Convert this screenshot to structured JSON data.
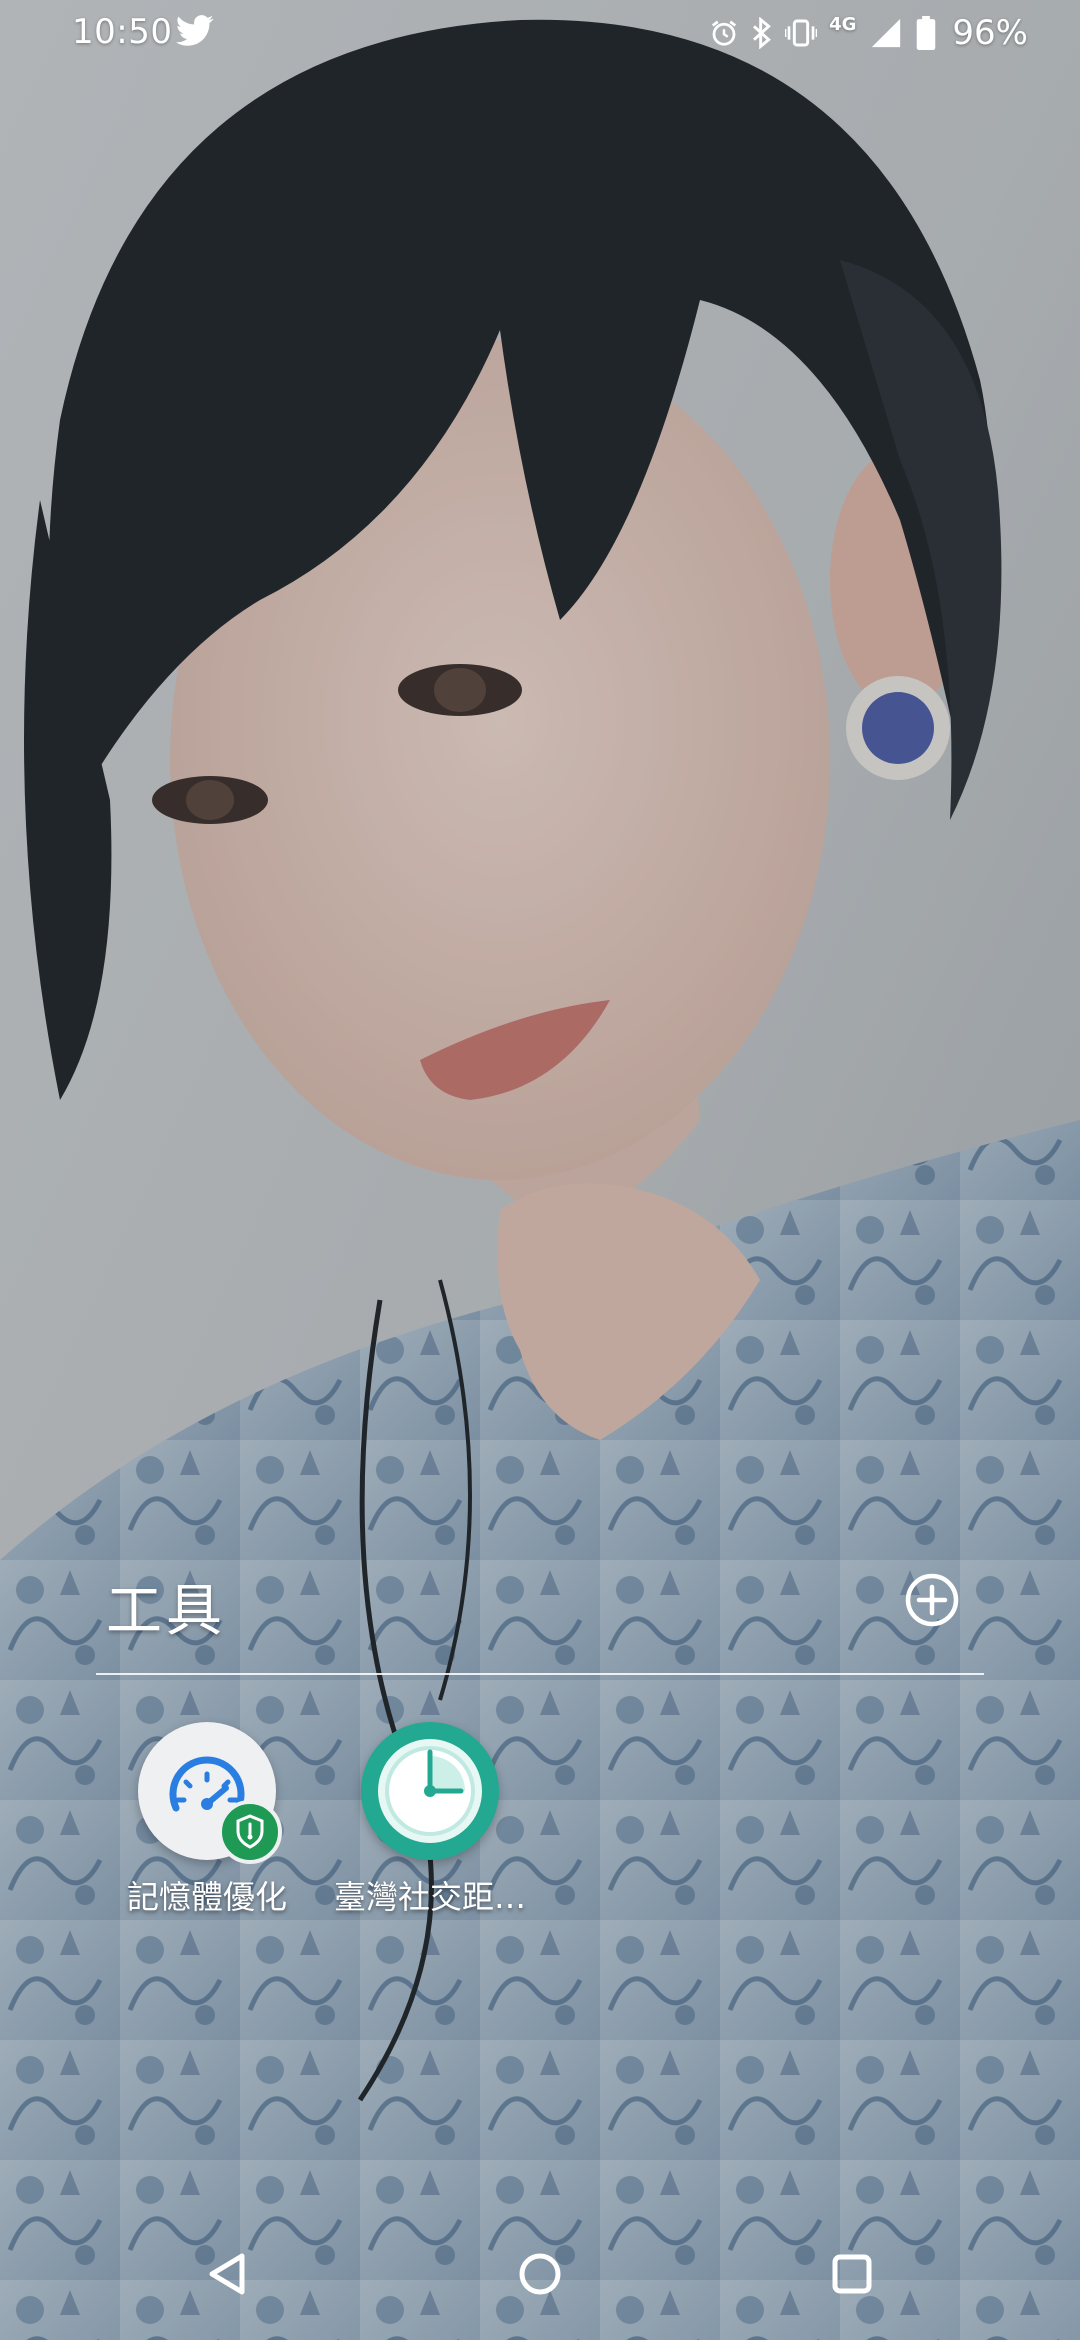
{
  "status_bar": {
    "time": "10:50",
    "notification_icon": "twitter-icon",
    "system_icons": [
      "alarm-icon",
      "bluetooth-icon",
      "vibrate-icon",
      "network-4g-icon",
      "signal-icon",
      "battery-icon"
    ],
    "network_type": "4G",
    "battery_percent": "96%"
  },
  "folder": {
    "title": "工具",
    "add_icon": "add-circle-icon",
    "apps": [
      {
        "label": "記憶體優化",
        "icon": "speedometer-shield-icon",
        "icon_bg": "#eef0f2",
        "accent": "#2a7de1"
      },
      {
        "label": "臺灣社交距…",
        "icon": "clock-icon",
        "icon_bg": "#23a891",
        "accent": "#dff6f2"
      }
    ]
  },
  "navigation": {
    "back_icon": "back-triangle-icon",
    "home_icon": "home-circle-icon",
    "recents_icon": "recents-square-icon"
  }
}
